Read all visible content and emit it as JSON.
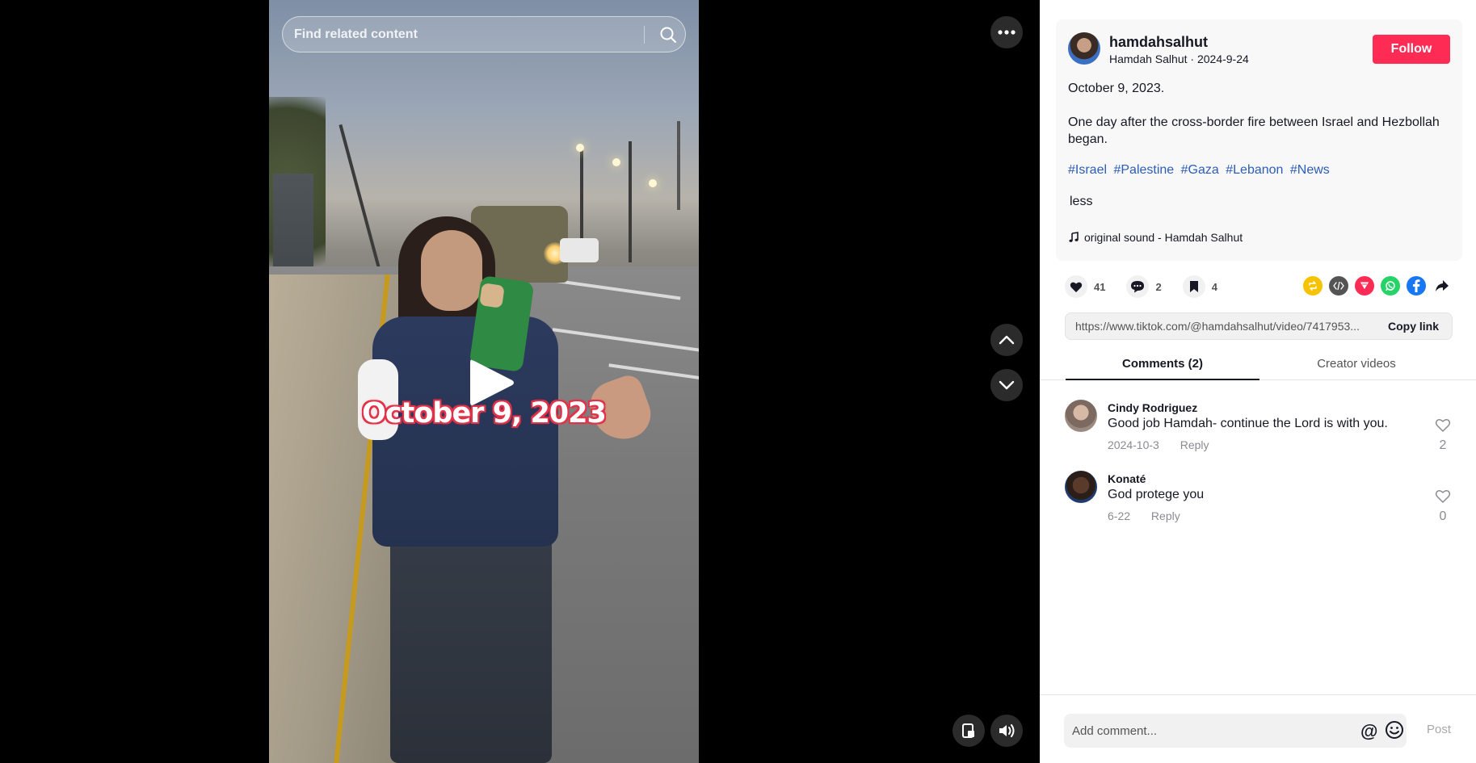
{
  "video": {
    "caption": "October 9, 2023",
    "search_placeholder": "Find related content"
  },
  "author": {
    "username": "hamdahsalhut",
    "display_name": "Hamdah Salhut",
    "post_date": "2024-9-24",
    "follow_label": "Follow"
  },
  "description": {
    "line1": "October 9, 2023.",
    "line2": "One day after the cross-border fire between Israel and Hezbollah began.",
    "hashtags": [
      "#Israel",
      "#Palestine",
      "#Gaza",
      "#Lebanon",
      "#News"
    ],
    "less_label": "less"
  },
  "sound": {
    "label": "original sound - Hamdah Salhut"
  },
  "stats": {
    "likes": "41",
    "comments": "2",
    "saves": "4"
  },
  "share_icons": [
    {
      "name": "repost-icon",
      "color": "#f7c300"
    },
    {
      "name": "embed-icon",
      "color": "#545454"
    },
    {
      "name": "send-icon",
      "color": "#fe2c55"
    },
    {
      "name": "whatsapp-icon",
      "color": "#25d366"
    },
    {
      "name": "facebook-icon",
      "color": "#1877f2"
    },
    {
      "name": "share-arrow-icon",
      "color": "#161823"
    }
  ],
  "link": {
    "url": "https://www.tiktok.com/@hamdahsalhut/video/7417953...",
    "copy_label": "Copy link"
  },
  "tabs": {
    "comments": "Comments (2)",
    "creator_videos": "Creator videos"
  },
  "comments": [
    {
      "user": "Cindy Rodriguez",
      "text": "Good job Hamdah- continue the Lord is with you.",
      "date": "2024-10-3",
      "reply": "Reply",
      "likes": "2"
    },
    {
      "user": "Konaté",
      "text": "God protege you",
      "date": "6-22",
      "reply": "Reply",
      "likes": "0"
    }
  ],
  "composer": {
    "placeholder": "Add comment...",
    "at_symbol": "@",
    "post_label": "Post"
  },
  "colors": {
    "accent": "#fe2c55",
    "hashtag": "#2b5db9"
  }
}
